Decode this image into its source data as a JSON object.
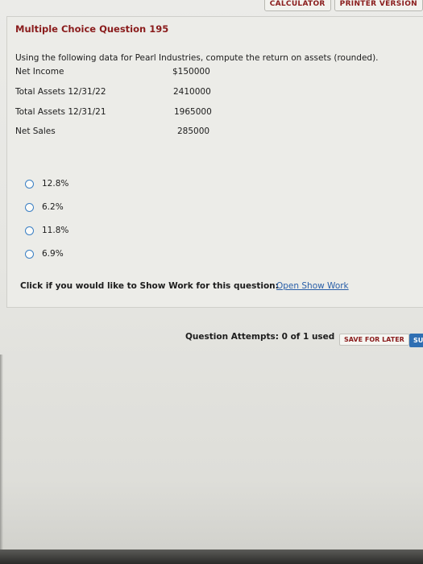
{
  "top_buttons": {
    "calculator": "CALCULATOR",
    "printer": "PRINTER VERSION"
  },
  "question": {
    "title": "Multiple Choice Question 195",
    "prompt": "Using the following data for Pearl Industries, compute the return on assets (rounded).",
    "data_rows": [
      {
        "label": "Net Income",
        "value": "$150000"
      },
      {
        "label": "Total Assets 12/31/22",
        "value": "2410000"
      },
      {
        "label": "Total Assets 12/31/21",
        "value": "1965000"
      },
      {
        "label": "Net Sales",
        "value": "285000"
      }
    ],
    "options": [
      "12.8%",
      "6.2%",
      "11.8%",
      "6.9%"
    ],
    "show_work_label": "Click if you would like to Show Work for this question:",
    "show_work_link": "Open Show Work"
  },
  "footer": {
    "attempts": "Question Attempts: 0 of 1 used",
    "save_later": "SAVE FOR LATER",
    "submit": "SU"
  }
}
